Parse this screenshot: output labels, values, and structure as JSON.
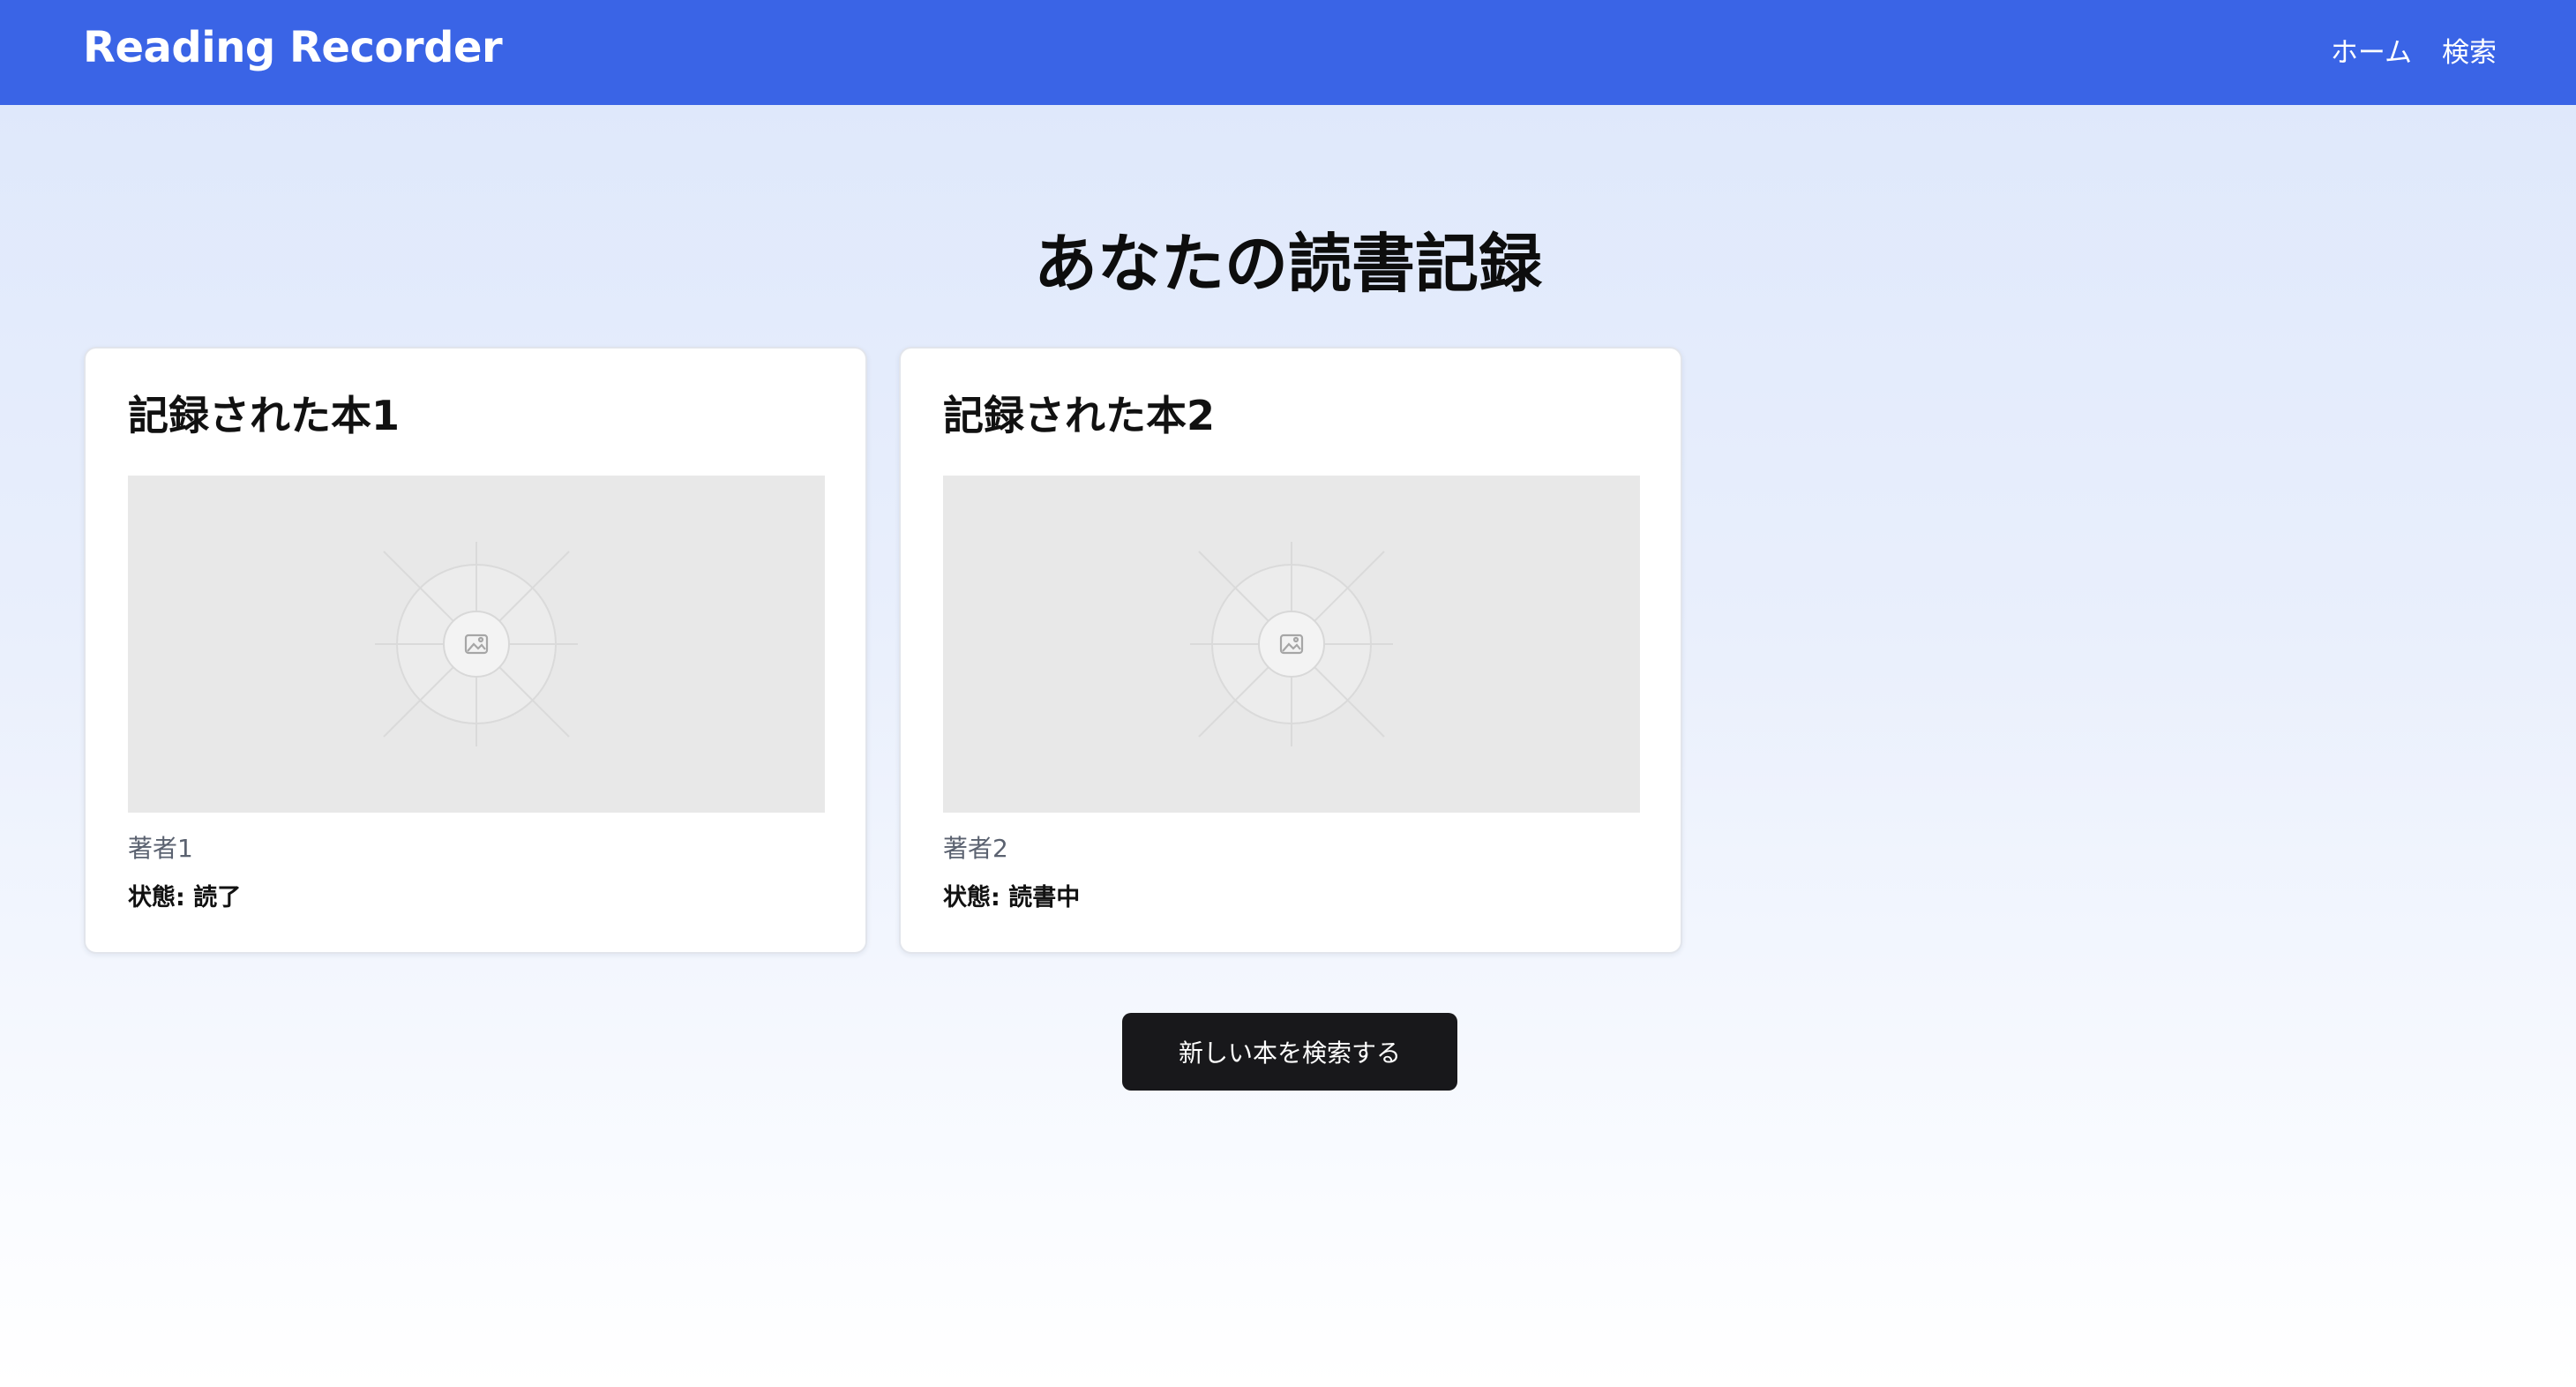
{
  "header": {
    "brand": "Reading Recorder",
    "nav": [
      {
        "label": "ホーム"
      },
      {
        "label": "検索"
      }
    ]
  },
  "main": {
    "title": "あなたの読書記録",
    "books": [
      {
        "title": "記録された本1",
        "author": "著者1",
        "status": "状態: 読了",
        "image_icon": "image-placeholder-icon"
      },
      {
        "title": "記録された本2",
        "author": "著者2",
        "status": "状態: 読書中",
        "image_icon": "image-placeholder-icon"
      }
    ],
    "search_button_label": "新しい本を検索する"
  },
  "colors": {
    "navbar": "#3a64e6",
    "button": "#18181b",
    "background_top": "#dde7fb",
    "background_bottom": "#ffffff"
  }
}
